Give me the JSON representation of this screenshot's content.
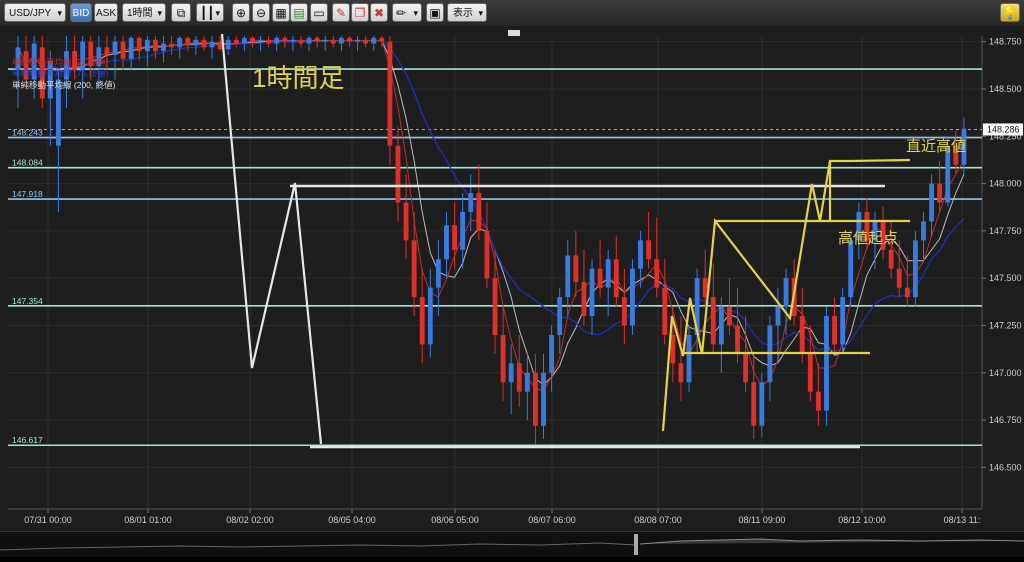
{
  "toolbar": {
    "symbol": "USD/JPY",
    "bid_label": "BID",
    "ask_label": "ASK",
    "timeframe": "1時間",
    "display_label": "表示"
  },
  "legend": {
    "ma_short": "単純移動平均線 (21,終値)",
    "ma_mid": "単純移動平均線 (75,終値)",
    "ma_long": "単純移動平均線 (200, 終値)"
  },
  "annotations": {
    "timeframe_note": "1時間足",
    "recent_high": "直近高値",
    "high_start": "高値起点"
  },
  "chart_data": {
    "type": "candlestick",
    "title": "",
    "symbol": "USD/JPY",
    "ylim": [
      146.28,
      148.78
    ],
    "y_ticks": [
      "148.750",
      "148.500",
      "148.250",
      "148.000",
      "147.750",
      "147.500",
      "147.250",
      "147.000",
      "146.750",
      "146.500"
    ],
    "x_ticks": [
      "07/31 00:00",
      "08/01 01:00",
      "08/02 02:00",
      "08/05 04:00",
      "08/06 05:00",
      "08/07 06:00",
      "08/08 07:00",
      "08/11 09:00",
      "08/12 10:00",
      "08/13 11:"
    ],
    "current_price": "148.286",
    "horizontal_lines": [
      {
        "value": 148.605,
        "label": "",
        "color": "#9fe8d5"
      },
      {
        "value": 148.243,
        "label": "148.243",
        "color": "#8ec4f2"
      },
      {
        "value": 148.084,
        "label": "148.084",
        "color": "#9fe8d5"
      },
      {
        "value": 147.918,
        "label": "147.918",
        "color": "#8ec4f2"
      },
      {
        "value": 147.354,
        "label": "147.354",
        "color": "#9fe8d5"
      },
      {
        "value": 146.617,
        "label": "146.617",
        "color": "#9fe8d5"
      }
    ],
    "candles": [
      {
        "i": 0,
        "o": 148.6,
        "h": 148.78,
        "l": 148.4,
        "c": 148.72
      },
      {
        "i": 1,
        "o": 148.7,
        "h": 148.78,
        "l": 148.5,
        "c": 148.55
      },
      {
        "i": 2,
        "o": 148.55,
        "h": 148.78,
        "l": 148.45,
        "c": 148.74
      },
      {
        "i": 3,
        "o": 148.72,
        "h": 148.78,
        "l": 148.4,
        "c": 148.45
      },
      {
        "i": 4,
        "o": 148.45,
        "h": 148.7,
        "l": 148.2,
        "c": 148.65
      },
      {
        "i": 5,
        "o": 148.2,
        "h": 148.6,
        "l": 147.85,
        "c": 148.55
      },
      {
        "i": 6,
        "o": 148.55,
        "h": 148.78,
        "l": 148.4,
        "c": 148.7
      },
      {
        "i": 7,
        "o": 148.7,
        "h": 148.78,
        "l": 148.55,
        "c": 148.6
      },
      {
        "i": 8,
        "o": 148.6,
        "h": 148.78,
        "l": 148.45,
        "c": 148.75
      },
      {
        "i": 9,
        "o": 148.75,
        "h": 148.78,
        "l": 148.55,
        "c": 148.62
      },
      {
        "i": 10,
        "o": 148.62,
        "h": 148.78,
        "l": 148.5,
        "c": 148.72
      },
      {
        "i": 11,
        "o": 148.72,
        "h": 148.78,
        "l": 148.6,
        "c": 148.68
      },
      {
        "i": 12,
        "o": 148.68,
        "h": 148.78,
        "l": 148.55,
        "c": 148.75
      },
      {
        "i": 13,
        "o": 148.75,
        "h": 148.78,
        "l": 148.6,
        "c": 148.66
      },
      {
        "i": 14,
        "o": 148.66,
        "h": 148.78,
        "l": 148.6,
        "c": 148.77
      },
      {
        "i": 15,
        "o": 148.77,
        "h": 148.78,
        "l": 148.65,
        "c": 148.7
      },
      {
        "i": 16,
        "o": 148.7,
        "h": 148.78,
        "l": 148.62,
        "c": 148.76
      },
      {
        "i": 17,
        "o": 148.76,
        "h": 148.78,
        "l": 148.66,
        "c": 148.7
      },
      {
        "i": 18,
        "o": 148.7,
        "h": 148.78,
        "l": 148.64,
        "c": 148.74
      },
      {
        "i": 19,
        "o": 148.74,
        "h": 148.78,
        "l": 148.68,
        "c": 148.72
      },
      {
        "i": 20,
        "o": 148.72,
        "h": 148.78,
        "l": 148.66,
        "c": 148.77
      },
      {
        "i": 21,
        "o": 148.77,
        "h": 148.78,
        "l": 148.7,
        "c": 148.73
      },
      {
        "i": 22,
        "o": 148.73,
        "h": 148.78,
        "l": 148.68,
        "c": 148.76
      },
      {
        "i": 23,
        "o": 148.76,
        "h": 148.78,
        "l": 148.7,
        "c": 148.72
      },
      {
        "i": 24,
        "o": 148.72,
        "h": 148.78,
        "l": 148.66,
        "c": 148.75
      },
      {
        "i": 25,
        "o": 148.75,
        "h": 148.78,
        "l": 148.7,
        "c": 148.71
      },
      {
        "i": 26,
        "o": 148.71,
        "h": 148.78,
        "l": 148.68,
        "c": 148.76
      },
      {
        "i": 27,
        "o": 148.76,
        "h": 148.78,
        "l": 148.72,
        "c": 148.74
      },
      {
        "i": 28,
        "o": 148.74,
        "h": 148.78,
        "l": 148.7,
        "c": 148.77
      },
      {
        "i": 29,
        "o": 148.77,
        "h": 148.78,
        "l": 148.72,
        "c": 148.75
      },
      {
        "i": 30,
        "o": 148.75,
        "h": 148.78,
        "l": 148.7,
        "c": 148.76
      },
      {
        "i": 31,
        "o": 148.76,
        "h": 148.78,
        "l": 148.72,
        "c": 148.74
      },
      {
        "i": 32,
        "o": 148.74,
        "h": 148.78,
        "l": 148.7,
        "c": 148.77
      },
      {
        "i": 33,
        "o": 148.77,
        "h": 148.78,
        "l": 148.72,
        "c": 148.75
      },
      {
        "i": 34,
        "o": 148.75,
        "h": 148.78,
        "l": 148.7,
        "c": 148.76
      },
      {
        "i": 35,
        "o": 148.76,
        "h": 148.78,
        "l": 148.72,
        "c": 148.74
      },
      {
        "i": 36,
        "o": 148.74,
        "h": 148.78,
        "l": 148.7,
        "c": 148.77
      },
      {
        "i": 37,
        "o": 148.77,
        "h": 148.78,
        "l": 148.72,
        "c": 148.75
      },
      {
        "i": 38,
        "o": 148.75,
        "h": 148.78,
        "l": 148.7,
        "c": 148.76
      },
      {
        "i": 39,
        "o": 148.76,
        "h": 148.78,
        "l": 148.72,
        "c": 148.74
      },
      {
        "i": 40,
        "o": 148.74,
        "h": 148.78,
        "l": 148.7,
        "c": 148.77
      },
      {
        "i": 41,
        "o": 148.77,
        "h": 148.78,
        "l": 148.72,
        "c": 148.75
      },
      {
        "i": 42,
        "o": 148.75,
        "h": 148.78,
        "l": 148.7,
        "c": 148.76
      },
      {
        "i": 43,
        "o": 148.76,
        "h": 148.78,
        "l": 148.72,
        "c": 148.74
      },
      {
        "i": 44,
        "o": 148.74,
        "h": 148.78,
        "l": 148.7,
        "c": 148.77
      },
      {
        "i": 45,
        "o": 148.77,
        "h": 148.78,
        "l": 148.72,
        "c": 148.75
      },
      {
        "i": 46,
        "o": 148.75,
        "h": 148.78,
        "l": 148.1,
        "c": 148.2
      },
      {
        "i": 47,
        "o": 148.2,
        "h": 148.3,
        "l": 147.8,
        "c": 147.9
      },
      {
        "i": 48,
        "o": 147.9,
        "h": 148.05,
        "l": 147.6,
        "c": 147.7
      },
      {
        "i": 49,
        "o": 147.7,
        "h": 147.85,
        "l": 147.3,
        "c": 147.4
      },
      {
        "i": 50,
        "o": 147.4,
        "h": 147.55,
        "l": 147.05,
        "c": 147.15
      },
      {
        "i": 51,
        "o": 147.15,
        "h": 147.55,
        "l": 147.08,
        "c": 147.45
      },
      {
        "i": 52,
        "o": 147.45,
        "h": 147.7,
        "l": 147.3,
        "c": 147.6
      },
      {
        "i": 53,
        "o": 147.6,
        "h": 147.85,
        "l": 147.5,
        "c": 147.78
      },
      {
        "i": 54,
        "o": 147.78,
        "h": 147.9,
        "l": 147.55,
        "c": 147.65
      },
      {
        "i": 55,
        "o": 147.65,
        "h": 147.95,
        "l": 147.55,
        "c": 147.85
      },
      {
        "i": 56,
        "o": 147.85,
        "h": 148.05,
        "l": 147.75,
        "c": 147.95
      },
      {
        "i": 57,
        "o": 147.95,
        "h": 148.1,
        "l": 147.7,
        "c": 147.75
      },
      {
        "i": 58,
        "o": 147.75,
        "h": 147.9,
        "l": 147.45,
        "c": 147.5
      },
      {
        "i": 59,
        "o": 147.5,
        "h": 147.65,
        "l": 147.1,
        "c": 147.2
      },
      {
        "i": 60,
        "o": 147.2,
        "h": 147.35,
        "l": 146.85,
        "c": 146.95
      },
      {
        "i": 61,
        "o": 146.95,
        "h": 147.15,
        "l": 146.78,
        "c": 147.05
      },
      {
        "i": 62,
        "o": 147.05,
        "h": 147.2,
        "l": 146.82,
        "c": 146.9
      },
      {
        "i": 63,
        "o": 146.9,
        "h": 147.1,
        "l": 146.75,
        "c": 147.0
      },
      {
        "i": 64,
        "o": 147.0,
        "h": 147.1,
        "l": 146.62,
        "c": 146.72
      },
      {
        "i": 65,
        "o": 146.72,
        "h": 147.1,
        "l": 146.65,
        "c": 147.0
      },
      {
        "i": 66,
        "o": 147.0,
        "h": 147.25,
        "l": 146.9,
        "c": 147.2
      },
      {
        "i": 67,
        "o": 147.2,
        "h": 147.45,
        "l": 147.1,
        "c": 147.4
      },
      {
        "i": 68,
        "o": 147.4,
        "h": 147.7,
        "l": 147.3,
        "c": 147.62
      },
      {
        "i": 69,
        "o": 147.62,
        "h": 147.75,
        "l": 147.4,
        "c": 147.48
      },
      {
        "i": 70,
        "o": 147.48,
        "h": 147.65,
        "l": 147.25,
        "c": 147.3
      },
      {
        "i": 71,
        "o": 147.3,
        "h": 147.6,
        "l": 147.2,
        "c": 147.55
      },
      {
        "i": 72,
        "o": 147.55,
        "h": 147.7,
        "l": 147.4,
        "c": 147.45
      },
      {
        "i": 73,
        "o": 147.45,
        "h": 147.65,
        "l": 147.3,
        "c": 147.6
      },
      {
        "i": 74,
        "o": 147.6,
        "h": 147.72,
        "l": 147.35,
        "c": 147.4
      },
      {
        "i": 75,
        "o": 147.4,
        "h": 147.55,
        "l": 147.15,
        "c": 147.25
      },
      {
        "i": 76,
        "o": 147.25,
        "h": 147.6,
        "l": 147.2,
        "c": 147.55
      },
      {
        "i": 77,
        "o": 147.55,
        "h": 147.75,
        "l": 147.45,
        "c": 147.7
      },
      {
        "i": 78,
        "o": 147.7,
        "h": 147.85,
        "l": 147.55,
        "c": 147.6
      },
      {
        "i": 79,
        "o": 147.6,
        "h": 147.82,
        "l": 147.4,
        "c": 147.45
      },
      {
        "i": 80,
        "o": 147.45,
        "h": 147.6,
        "l": 147.15,
        "c": 147.2
      },
      {
        "i": 81,
        "o": 147.2,
        "h": 147.35,
        "l": 146.95,
        "c": 147.05
      },
      {
        "i": 82,
        "o": 147.05,
        "h": 147.3,
        "l": 146.85,
        "c": 146.95
      },
      {
        "i": 83,
        "o": 146.95,
        "h": 147.25,
        "l": 146.9,
        "c": 147.2
      },
      {
        "i": 84,
        "o": 147.2,
        "h": 147.55,
        "l": 147.1,
        "c": 147.5
      },
      {
        "i": 85,
        "o": 147.5,
        "h": 147.65,
        "l": 147.35,
        "c": 147.4
      },
      {
        "i": 86,
        "o": 147.4,
        "h": 147.58,
        "l": 147.1,
        "c": 147.15
      },
      {
        "i": 87,
        "o": 147.15,
        "h": 147.4,
        "l": 147.0,
        "c": 147.35
      },
      {
        "i": 88,
        "o": 147.35,
        "h": 147.5,
        "l": 147.2,
        "c": 147.25
      },
      {
        "i": 89,
        "o": 147.25,
        "h": 147.45,
        "l": 147.05,
        "c": 147.1
      },
      {
        "i": 90,
        "o": 147.1,
        "h": 147.3,
        "l": 146.9,
        "c": 146.95
      },
      {
        "i": 91,
        "o": 146.95,
        "h": 147.1,
        "l": 146.65,
        "c": 146.72
      },
      {
        "i": 92,
        "o": 146.72,
        "h": 147.0,
        "l": 146.66,
        "c": 146.95
      },
      {
        "i": 93,
        "o": 146.95,
        "h": 147.3,
        "l": 146.85,
        "c": 147.25
      },
      {
        "i": 94,
        "o": 147.25,
        "h": 147.45,
        "l": 147.05,
        "c": 147.35
      },
      {
        "i": 95,
        "o": 147.35,
        "h": 147.55,
        "l": 147.2,
        "c": 147.5
      },
      {
        "i": 96,
        "o": 147.5,
        "h": 147.6,
        "l": 147.25,
        "c": 147.3
      },
      {
        "i": 97,
        "o": 147.3,
        "h": 147.45,
        "l": 147.05,
        "c": 147.1
      },
      {
        "i": 98,
        "o": 147.1,
        "h": 147.25,
        "l": 146.85,
        "c": 146.9
      },
      {
        "i": 99,
        "o": 146.9,
        "h": 147.05,
        "l": 146.72,
        "c": 146.8
      },
      {
        "i": 100,
        "o": 146.8,
        "h": 147.35,
        "l": 146.72,
        "c": 147.3
      },
      {
        "i": 101,
        "o": 147.3,
        "h": 147.4,
        "l": 147.1,
        "c": 147.15
      },
      {
        "i": 102,
        "o": 147.15,
        "h": 147.45,
        "l": 147.1,
        "c": 147.4
      },
      {
        "i": 103,
        "o": 147.4,
        "h": 147.75,
        "l": 147.35,
        "c": 147.7
      },
      {
        "i": 104,
        "o": 147.7,
        "h": 147.9,
        "l": 147.6,
        "c": 147.85
      },
      {
        "i": 105,
        "o": 147.85,
        "h": 147.92,
        "l": 147.65,
        "c": 147.7
      },
      {
        "i": 106,
        "o": 147.7,
        "h": 147.85,
        "l": 147.55,
        "c": 147.8
      },
      {
        "i": 107,
        "o": 147.8,
        "h": 147.88,
        "l": 147.6,
        "c": 147.65
      },
      {
        "i": 108,
        "o": 147.65,
        "h": 147.8,
        "l": 147.5,
        "c": 147.55
      },
      {
        "i": 109,
        "o": 147.55,
        "h": 147.7,
        "l": 147.4,
        "c": 147.45
      },
      {
        "i": 110,
        "o": 147.45,
        "h": 147.62,
        "l": 147.35,
        "c": 147.4
      },
      {
        "i": 111,
        "o": 147.4,
        "h": 147.75,
        "l": 147.35,
        "c": 147.7
      },
      {
        "i": 112,
        "o": 147.7,
        "h": 147.85,
        "l": 147.6,
        "c": 147.8
      },
      {
        "i": 113,
        "o": 147.8,
        "h": 148.05,
        "l": 147.72,
        "c": 148.0
      },
      {
        "i": 114,
        "o": 148.0,
        "h": 148.12,
        "l": 147.85,
        "c": 147.9
      },
      {
        "i": 115,
        "o": 147.9,
        "h": 148.25,
        "l": 147.88,
        "c": 148.2
      },
      {
        "i": 116,
        "o": 148.2,
        "h": 148.28,
        "l": 148.05,
        "c": 148.1
      },
      {
        "i": 117,
        "o": 148.1,
        "h": 148.35,
        "l": 148.05,
        "c": 148.29
      }
    ],
    "moving_averages": [
      {
        "name": "単純移動平均線 (21,終値)",
        "color": "#c0302a"
      },
      {
        "name": "単純移動平均線 (75,終値)",
        "color": "#1f2fb0"
      },
      {
        "name": "単純移動平均線 (200, 終値)",
        "color": "#bdbdbd"
      }
    ]
  }
}
